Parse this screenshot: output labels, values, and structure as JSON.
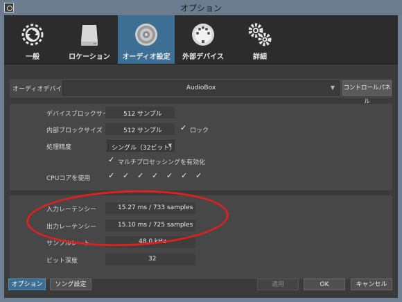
{
  "window": {
    "title": "オプション"
  },
  "toolbar": {
    "items": [
      {
        "label": "一般",
        "icon": "sync-gear-icon"
      },
      {
        "label": "ロケーション",
        "icon": "drive-icon"
      },
      {
        "label": "オーディオ設定",
        "icon": "speaker-icon",
        "active": true
      },
      {
        "label": "外部デバイス",
        "icon": "midi-port-icon"
      },
      {
        "label": "詳細",
        "icon": "gears-icon"
      }
    ]
  },
  "device": {
    "label": "オーディオデバイス",
    "value": "AudioBox",
    "control_panel_label": "コントロールパネル"
  },
  "settings": {
    "device_block_size_label": "デバイスブロックサイズ",
    "device_block_size_value": "512 サンプル",
    "internal_block_size_label": "内部ブロックサイズ",
    "internal_block_size_value": "512 サンプル",
    "lock_label": "ロック",
    "precision_label": "処理精度",
    "precision_value": "シングル（32ビット）",
    "multiprocessing_label": "マルチプロセッシングを有効化",
    "cpu_cores_label": "CPUコアを使用",
    "cpu_cores_count": 7
  },
  "info": {
    "input_latency_label": "入力レーテンシー",
    "input_latency_value": "15.27 ms / 733 samples",
    "output_latency_label": "出力レーテンシー",
    "output_latency_value": "15.10 ms / 725 samples",
    "sample_rate_label": "サンプルレート",
    "sample_rate_value": "48.0 kHz",
    "bit_depth_label": "ビット深度",
    "bit_depth_value": "32"
  },
  "footer": {
    "options_label": "オプション",
    "song_settings_label": "ソング設定",
    "apply_label": "適用",
    "ok_label": "OK",
    "cancel_label": "キャンセル"
  },
  "colors": {
    "active_tab": "#3d6f95",
    "annotation": "#e0201e"
  }
}
